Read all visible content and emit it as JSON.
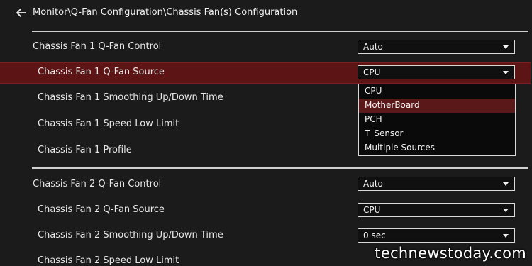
{
  "header": {
    "breadcrumb": "Monitor\\Q-Fan Configuration\\Chassis Fan(s) Configuration",
    "back_icon": "arrow-left-icon"
  },
  "rows": [
    {
      "label": "Chassis Fan 1 Q-Fan Control",
      "value": "Auto"
    },
    {
      "label": "Chassis Fan 1 Q-Fan Source",
      "value": "CPU"
    },
    {
      "label": "Chassis Fan 1 Smoothing Up/Down Time"
    },
    {
      "label": "Chassis Fan 1 Speed Low Limit"
    },
    {
      "label": "Chassis Fan 1 Profile"
    },
    {
      "label": "Chassis Fan 2 Q-Fan Control",
      "value": "Auto"
    },
    {
      "label": "Chassis Fan 2 Q-Fan Source",
      "value": "CPU"
    },
    {
      "label": "Chassis Fan 2 Smoothing Up/Down Time",
      "value": "0 sec"
    },
    {
      "label": "Chassis Fan 2 Speed Low Limit"
    }
  ],
  "source_dropdown": {
    "options": [
      "CPU",
      "MotherBoard",
      "PCH",
      "T_Sensor",
      "Multiple Sources"
    ],
    "highlighted": "MotherBoard"
  },
  "colors": {
    "highlight": "#5c1414",
    "background": "#1b1b1b"
  },
  "watermark": "technewstoday.com"
}
